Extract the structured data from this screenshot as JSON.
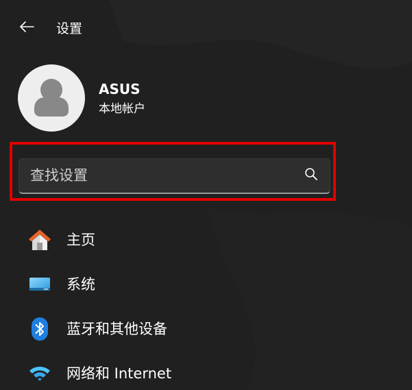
{
  "header": {
    "title": "设置",
    "back_icon": "arrow-left-icon"
  },
  "account": {
    "name": "ASUS",
    "type": "本地帐户",
    "avatar_icon": "person-icon"
  },
  "search": {
    "placeholder": "查找设置",
    "value": "",
    "icon": "search-icon",
    "highlight_color": "#e30000"
  },
  "nav": {
    "items": [
      {
        "label": "主页",
        "icon": "home-icon"
      },
      {
        "label": "系统",
        "icon": "display-icon"
      },
      {
        "label": "蓝牙和其他设备",
        "icon": "bluetooth-icon"
      },
      {
        "label": "网络和 Internet",
        "icon": "wifi-icon"
      }
    ]
  },
  "colors": {
    "background": "#202020",
    "search_background": "#2e2e2e",
    "highlight": "#e30000",
    "accent": "#4cc2ff"
  }
}
